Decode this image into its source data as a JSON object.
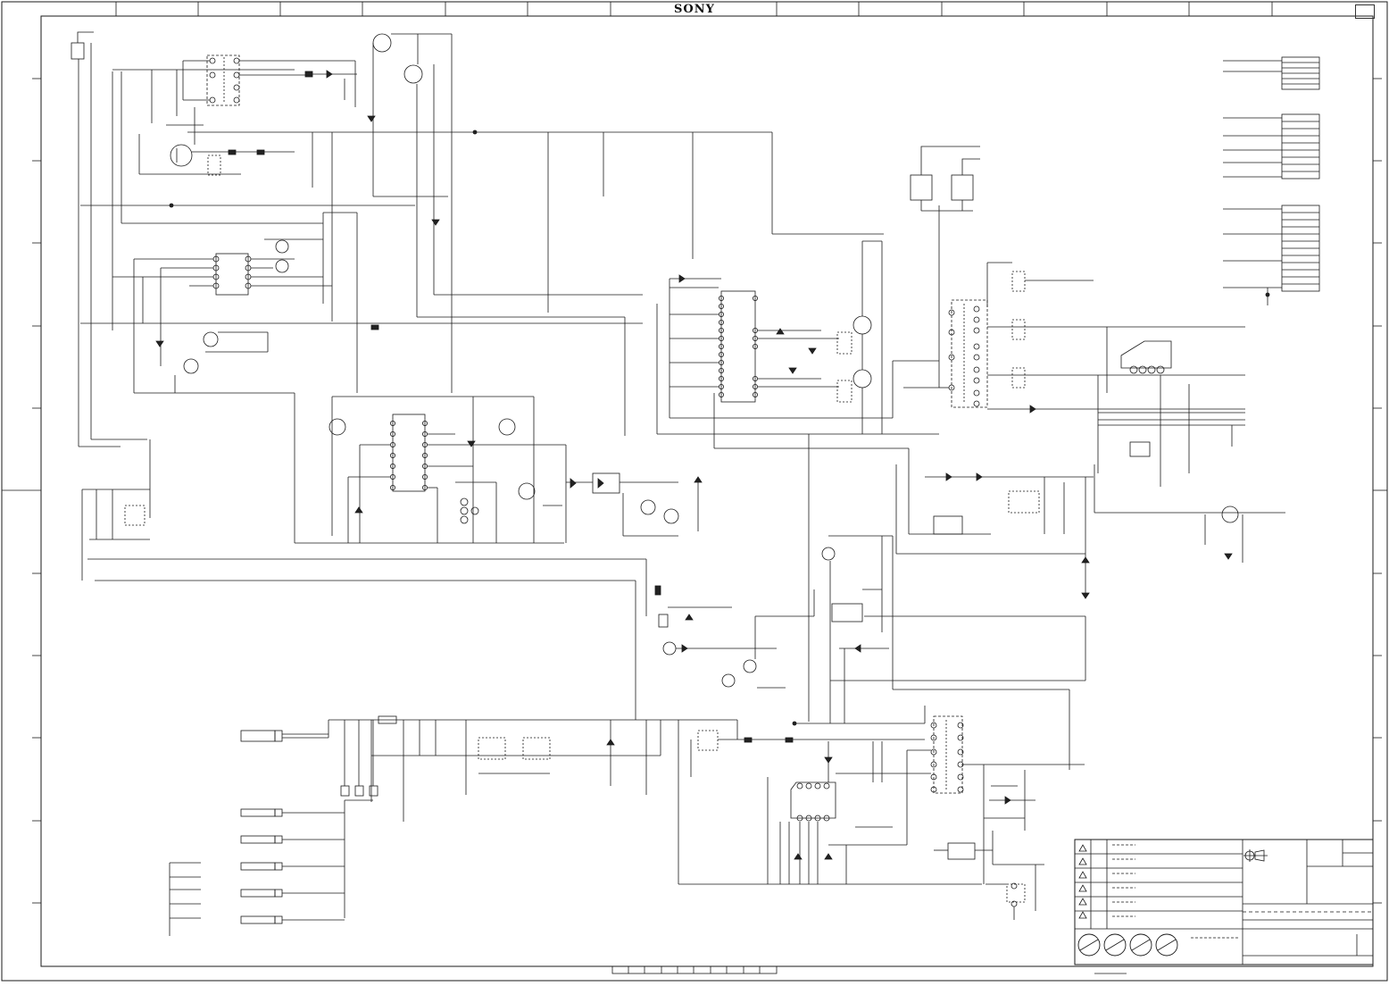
{
  "sheet": {
    "brand": "SONY",
    "page_badge": ""
  },
  "title_block": {
    "revision_marks": 6,
    "approval_stamps": 4
  }
}
